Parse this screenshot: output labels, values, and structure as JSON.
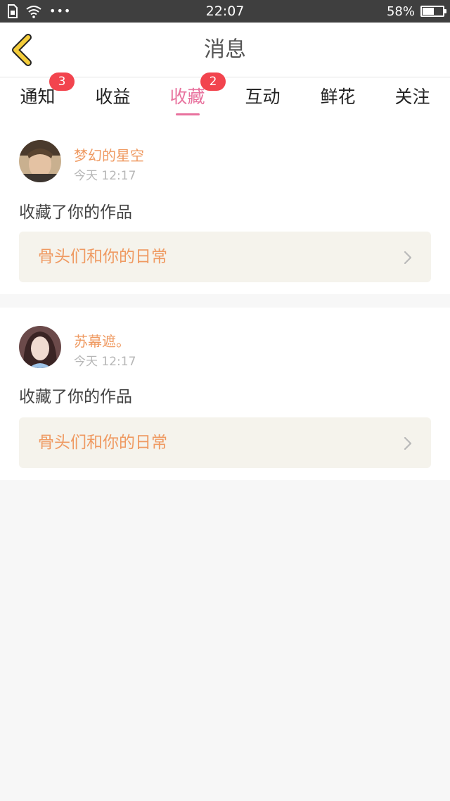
{
  "status_bar": {
    "time": "22:07",
    "battery_percent": "58%",
    "battery_level": 0.58,
    "signal_dots": "•••",
    "icons": [
      "sim-icon",
      "wifi-icon",
      "battery-icon"
    ]
  },
  "header": {
    "title": "消息",
    "back_icon": "chevron-left-icon",
    "back_icon_color": "#f3cc3a"
  },
  "tabs": [
    {
      "label": "通知",
      "badge": "3",
      "active": false
    },
    {
      "label": "收益",
      "badge": "",
      "active": false
    },
    {
      "label": "收藏",
      "badge": "2",
      "active": true
    },
    {
      "label": "互动",
      "badge": "",
      "active": false
    },
    {
      "label": "鲜花",
      "badge": "",
      "active": false
    },
    {
      "label": "关注",
      "badge": "",
      "active": false
    }
  ],
  "colors": {
    "accent": "#e8729e",
    "badge": "#f2444e",
    "name": "#ef9a62",
    "link_bg": "#f5f3ec"
  },
  "messages": [
    {
      "user_name": "梦幻的星空",
      "time": "今天 12:17",
      "action": "收藏了你的作品",
      "work_title": "骨头们和你的日常"
    },
    {
      "user_name": "苏幕遮。",
      "time": "今天 12:17",
      "action": "收藏了你的作品",
      "work_title": "骨头们和你的日常"
    }
  ]
}
